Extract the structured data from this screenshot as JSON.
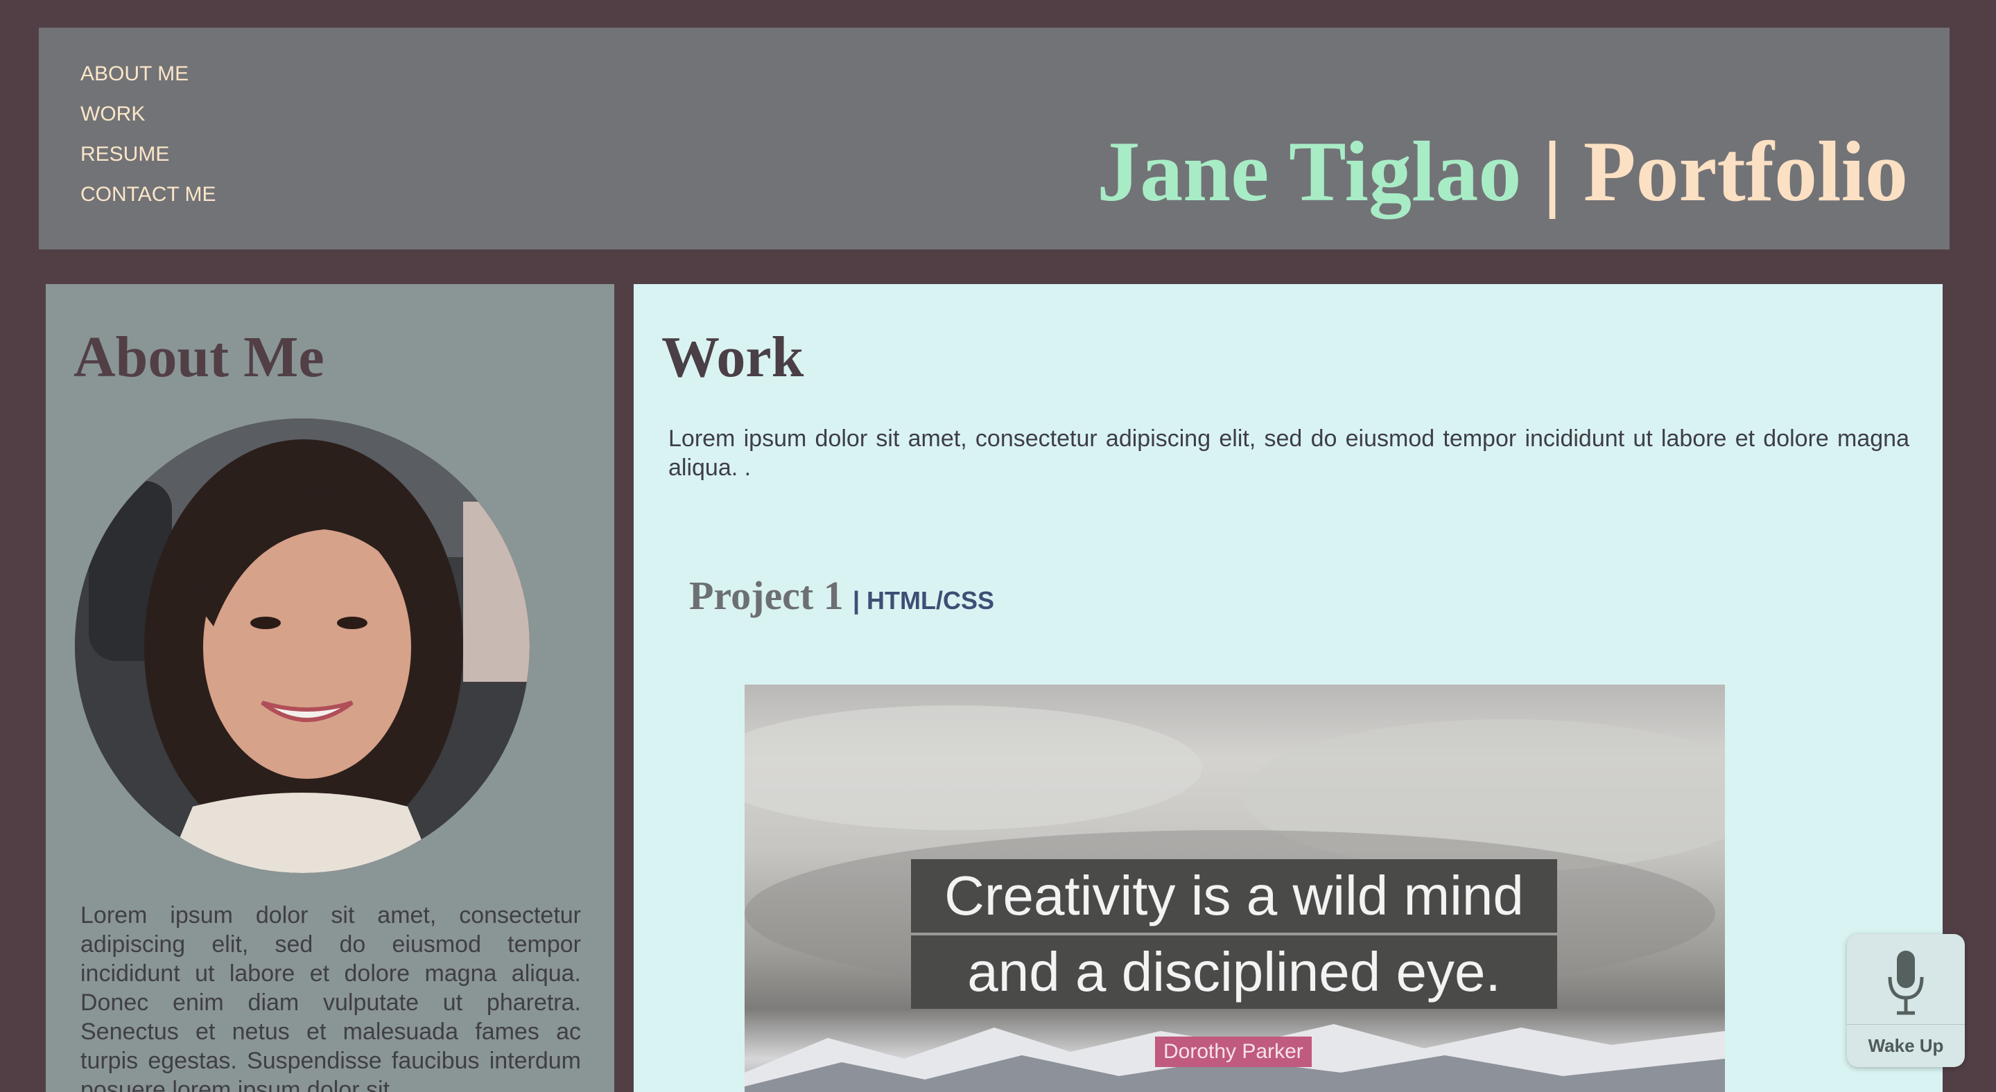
{
  "header": {
    "nav": [
      "ABOUT ME",
      "WORK",
      "RESUME",
      "CONTACT ME"
    ],
    "title_name": "Jane Tiglao",
    "title_sep": "|",
    "title_suffix": "Portfolio"
  },
  "about": {
    "heading": "About Me",
    "text": "Lorem ipsum dolor sit amet, consectetur adipiscing elit, sed do eiusmod tempor incididunt ut labore et dolore magna aliqua. Donec enim diam vulputate ut pharetra. Senectus et netus et malesuada fames ac turpis egestas. Suspendisse faucibus interdum posuere lorem ipsum dolor sit"
  },
  "work": {
    "heading": "Work",
    "intro": "Lorem ipsum dolor sit amet, consectetur adipiscing elit, sed do eiusmod tempor incididunt ut labore et dolore magna aliqua. .",
    "projects": [
      {
        "name": "Project 1",
        "tech": "| HTML/CSS",
        "quote_line1": "Creativity is a wild mind",
        "quote_line2": "and a disciplined eye.",
        "quote_author": "Dorothy Parker"
      }
    ]
  },
  "wake_widget": {
    "label": "Wake Up",
    "icon": "microphone-icon"
  },
  "colors": {
    "page_bg": "#523f46",
    "header_bg": "#727377",
    "title_accent": "#a8ecc6",
    "title_cream": "#fbe0c3",
    "about_bg": "#8a9596",
    "work_bg": "#d9f3f2"
  }
}
